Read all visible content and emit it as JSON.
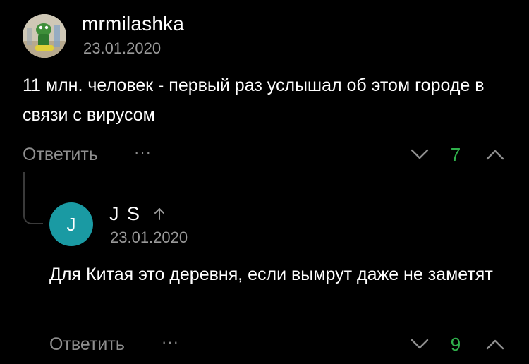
{
  "colors": {
    "background": "#000000",
    "text": "#ffffff",
    "muted": "#9a9a9a",
    "score_positive": "#2fb04b",
    "avatar_teal": "#1a9aa3"
  },
  "comment": {
    "author": "mrmilashka",
    "date": "23.01.2020",
    "text": "11 млн. человек - первый раз услышал об этом городе в связи с вирусом",
    "reply_label": "Ответить",
    "more_icon": "···",
    "score": "7",
    "avatar_icon": "user-photo-avatar"
  },
  "reply": {
    "avatar_letter": "J",
    "author": "J S",
    "reply_to_icon": "arrow-up-icon",
    "date": "23.01.2020",
    "text": "Для Китая это деревня, если вымрут даже не заметят",
    "reply_label": "Ответить",
    "more_icon": "···",
    "score": "9"
  }
}
